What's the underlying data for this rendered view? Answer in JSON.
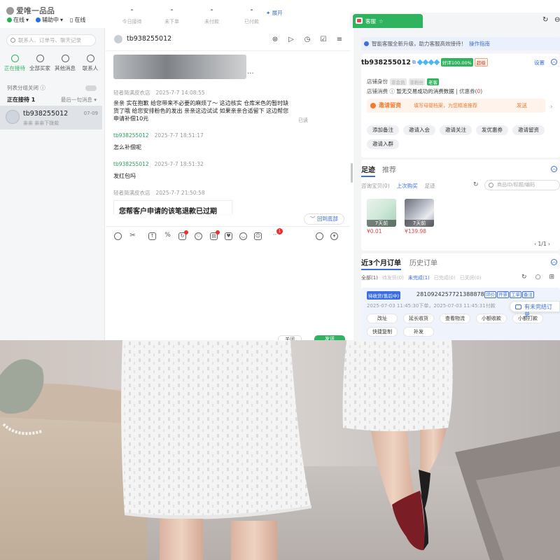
{
  "app": {
    "title": "爱唯一品品",
    "status_online": "在线",
    "status_assist": "辅助中",
    "status_pc_online": "在线",
    "expand_label": "展开"
  },
  "stats": [
    {
      "value": "-",
      "label": "今日接待"
    },
    {
      "value": "-",
      "label": "未下单"
    },
    {
      "value": "-",
      "label": "未付款"
    },
    {
      "value": "-",
      "label": "已付款"
    }
  ],
  "left": {
    "search_placeholder": "联系人、订单号、聊天记录",
    "tabs": [
      {
        "label": "正在接待",
        "icon": "message-icon"
      },
      {
        "label": "全部买家",
        "icon": "clock-icon"
      },
      {
        "label": "其他消息",
        "icon": "chat-icon"
      },
      {
        "label": "联系人",
        "icon": "person-icon"
      }
    ],
    "group_toggle_label": "列表分组关闭",
    "serving_label": "正在接待",
    "serving_count": "1",
    "sort_label": "最后一句消息",
    "conversation": {
      "name": "tb938255012",
      "time": "07-09",
      "preview": "亲亲 亲亲下拨款"
    }
  },
  "chat": {
    "contact_name": "tb938255012",
    "messages": [
      {
        "sender": "轻者简满皮衣店",
        "time": "2025-7-7 14:08:55",
        "lines": [
          "亲亲 实在抱歉 给您带来不必要的麻烦了～ 这边核实 仓库米色的暂时缺",
          "货了哦 给您安排粉色的发出 亲亲这边试试 如果亲亲合适留下 这边帮您",
          "申请补偿10元"
        ],
        "read": "已读"
      },
      {
        "sender": "tb938255012",
        "time": "2025-7-7 18:51:17",
        "lines": [
          "怎么补偿呢"
        ]
      },
      {
        "sender": "tb938255012",
        "time": "2025-7-7 18:51:32",
        "lines": [
          "发红包吗"
        ]
      },
      {
        "sender": "轻者简满皮衣店",
        "time": "2025-7-7 21:50:58",
        "lines": []
      }
    ],
    "card_title": "您帮客户申请的该笔退款已过期",
    "back_to_bottom": "回到底部",
    "more_badge": "1",
    "close_label": "关闭",
    "send_label": "发送"
  },
  "right": {
    "tab_label": "客服",
    "notice_text": "智能客服全新升级，助力客服高效接待！",
    "notice_link": "操作指南",
    "customer": {
      "name": "tb938255012",
      "good_rate": "好评100.00%",
      "vip": "超级",
      "setting_label": "设置",
      "identity_label": "店铺身份",
      "identity_tags": [
        "非会员",
        "非粉丝"
      ],
      "identity_tag_new": "老客",
      "consume_label": "店铺消费",
      "consume_text": "暂无交易成功的消费数据",
      "coupon_label": "优惠券",
      "coupon_count": "0"
    },
    "invite": {
      "title": "邀请留资",
      "desc": "填写母婴档案，为您精准推荐",
      "send": "发送"
    },
    "actions": [
      "添加备注",
      "邀请入会",
      "邀请关注",
      "发优惠券",
      "邀请留资",
      "邀请入群"
    ],
    "footprint": {
      "tabs": [
        "足迹",
        "推荐"
      ],
      "subtabs": [
        "咨询宝贝(0)",
        "上次购买",
        "足迹"
      ],
      "search_placeholder": "商品ID/标题/编码",
      "products": [
        {
          "days": "7天前",
          "price": "¥0.01"
        },
        {
          "days": "7天前",
          "price": "¥139.98"
        }
      ],
      "pager": "1/1"
    },
    "orders": {
      "tabs": [
        "近3个月订单",
        "历史订单"
      ],
      "filters": [
        "全部(1)",
        "待发货(0)",
        "未完成(1)",
        "已完成(0)",
        "已关闭(0)"
      ],
      "item": {
        "status": "待收货(售后中)",
        "order_no": "2810924257721388878",
        "tags": [
          "评价",
          "开票",
          "工单",
          "备注"
        ],
        "time": "2025-07-03 11:45:30下单，2025-07-03 11:45:31付款",
        "buttons": [
          "改址",
          "延长收货",
          "查看物流",
          "小额收款",
          "小额打款",
          "快捷复制",
          "补发"
        ]
      },
      "unfinished_label": "有未完结订单"
    }
  },
  "colors": {
    "brand_green": "#2fb35e",
    "link_blue": "#3b6ee0",
    "alert_orange": "#f07b2f",
    "price_red": "#e04646"
  }
}
